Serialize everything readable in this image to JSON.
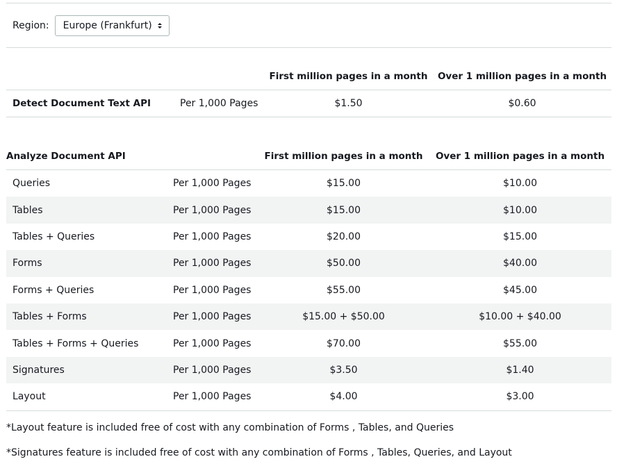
{
  "region": {
    "label": "Region:",
    "selected": "Europe (Frankfurt)",
    "options_visible": [
      "Europe (Frankfurt)"
    ]
  },
  "detect": {
    "headers": {
      "col3": "First million pages in a month",
      "col4": "Over 1 million pages in a month"
    },
    "row": {
      "name": "Detect Document Text API",
      "unit": "Per 1,000 Pages",
      "first": "$1.50",
      "over": "$0.60"
    }
  },
  "analyze": {
    "headers": {
      "col1": "Analyze Document API",
      "col3": "First million pages in a month",
      "col4": "Over 1 million pages in a month"
    },
    "rows": [
      {
        "name": "Queries",
        "unit": "Per 1,000 Pages",
        "first": "$15.00",
        "over": "$10.00"
      },
      {
        "name": "Tables",
        "unit": "Per 1,000 Pages",
        "first": "$15.00",
        "over": "$10.00"
      },
      {
        "name": "Tables + Queries",
        "unit": "Per 1,000 Pages",
        "first": "$20.00",
        "over": "$15.00"
      },
      {
        "name": "Forms",
        "unit": "Per 1,000 Pages",
        "first": "$50.00",
        "over": "$40.00"
      },
      {
        "name": "Forms + Queries",
        "unit": "Per 1,000 Pages",
        "first": "$55.00",
        "over": "$45.00"
      },
      {
        "name": "Tables + Forms",
        "unit": "Per 1,000 Pages",
        "first": "$15.00 + $50.00",
        "over": "$10.00 + $40.00"
      },
      {
        "name": "Tables + Forms + Queries",
        "unit": "Per 1,000 Pages",
        "first": "$70.00",
        "over": "$55.00"
      },
      {
        "name": "Signatures",
        "unit": "Per 1,000 Pages",
        "first": "$3.50",
        "over": "$1.40"
      },
      {
        "name": "Layout",
        "unit": "Per 1,000 Pages",
        "first": "$4.00",
        "over": "$3.00"
      }
    ]
  },
  "notes": [
    "*Layout feature is included free of cost with any combination of Forms , Tables, and Queries",
    "*Signatures feature is included free of cost with any combination of Forms , Tables, Queries, and Layout"
  ]
}
